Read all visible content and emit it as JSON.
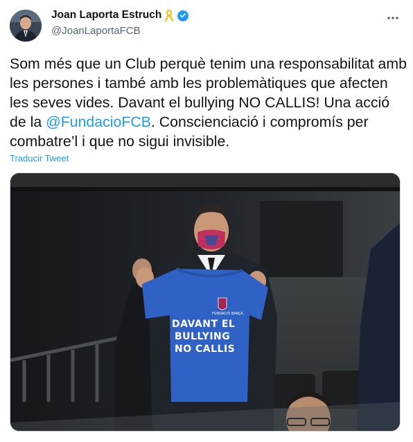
{
  "author": {
    "name": "Joan Laporta Estruch",
    "handle": "@JoanLaportaFCB",
    "ribbon_icon": "yellow-ribbon-icon",
    "verified_icon": "verified-badge-icon",
    "verified_color": "#1d9bf0"
  },
  "tweet": {
    "text_before_mention": "Som més que un Club perquè tenim una responsabilitat amb les persones i també amb les problemàtiques que afecten les seves vides. Davant el bullying NO CALLIS! Una acció de la ",
    "mention": "@FundacioFCB",
    "text_after_mention": ". Conscienciació i compromís per combatre’l i que no sigui invisible.",
    "translate_label": "Traducir Tweet",
    "link_color": "#1d9bf0"
  },
  "media": {
    "shirt_line1": "DAVANT EL",
    "shirt_line2": "BULLYING",
    "shirt_line3": "NO CALLIS",
    "shirt_logo_text": "FUNDACIÓ BARÇA",
    "shirt_color": "#2f62c4"
  }
}
